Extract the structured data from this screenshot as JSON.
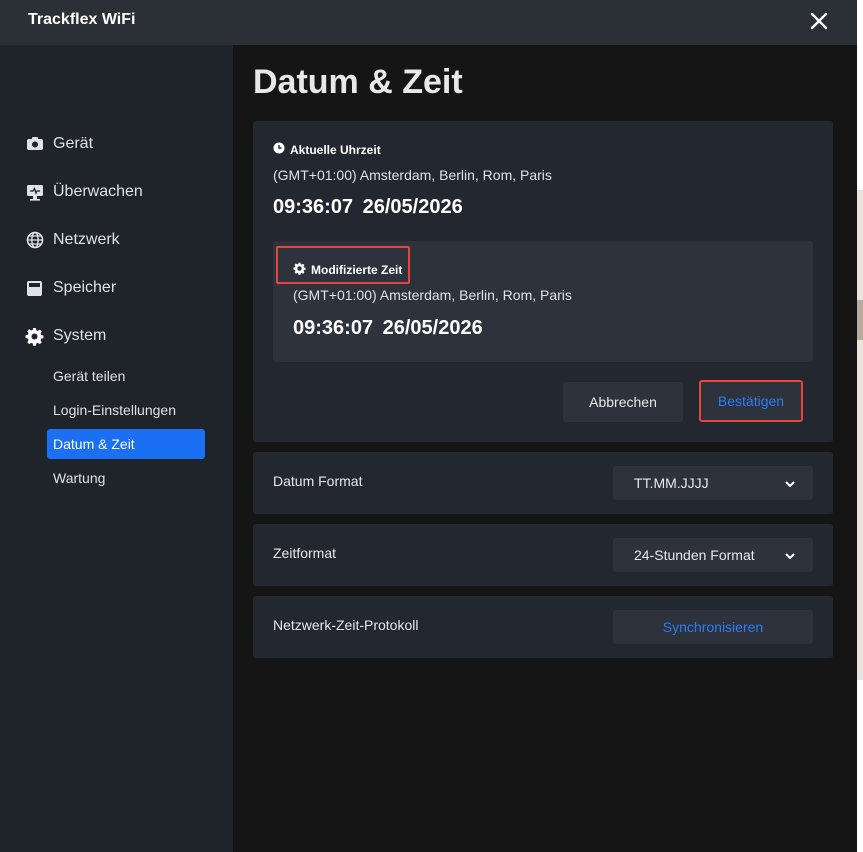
{
  "app": {
    "title": "Trackflex WiFi"
  },
  "sidebar": {
    "items": [
      {
        "label": "Gerät",
        "icon": "camera-icon"
      },
      {
        "label": "Überwachen",
        "icon": "monitor-icon"
      },
      {
        "label": "Netzwerk",
        "icon": "globe-icon"
      },
      {
        "label": "Speicher",
        "icon": "storage-icon"
      },
      {
        "label": "System",
        "icon": "gear-icon"
      }
    ],
    "sub_items": [
      {
        "label": "Gerät teilen"
      },
      {
        "label": "Login-Einstellungen"
      },
      {
        "label": "Datum & Zeit",
        "active": true
      },
      {
        "label": "Wartung"
      }
    ]
  },
  "main": {
    "title": "Datum & Zeit",
    "current": {
      "heading": "Aktuelle Uhrzeit",
      "timezone": "(GMT+01:00) Amsterdam, Berlin, Rom, Paris",
      "time": "09:36:07",
      "date": "26/05/2026"
    },
    "modified": {
      "heading": "Modifizierte Zeit",
      "timezone": "(GMT+01:00) Amsterdam, Berlin, Rom, Paris",
      "time": "09:36:07",
      "date": "26/05/2026"
    },
    "buttons": {
      "cancel": "Abbrechen",
      "confirm": "Bestätigen"
    },
    "date_format": {
      "label": "Datum Format",
      "value": "TT.MM.JJJJ"
    },
    "time_format": {
      "label": "Zeitformat",
      "value": "24-Stunden Format"
    },
    "ntp": {
      "label": "Netzwerk-Zeit-Protokoll",
      "button": "Synchronisieren"
    }
  },
  "colors": {
    "accent": "#1a6ff2",
    "highlight": "#e5473f",
    "link": "#2b7cf2"
  }
}
